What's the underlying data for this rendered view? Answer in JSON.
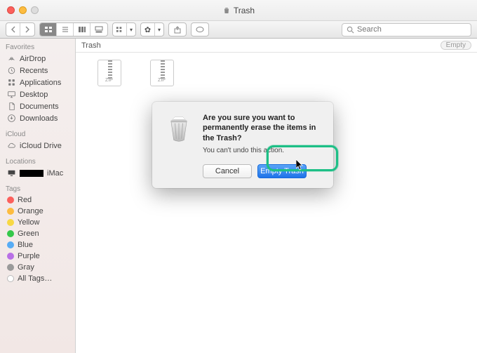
{
  "window": {
    "title": "Trash"
  },
  "toolbar": {
    "search_placeholder": "Search"
  },
  "pathbar": {
    "location": "Trash",
    "empty_label": "Empty"
  },
  "files": [
    {
      "type": "ZIP"
    },
    {
      "type": "ZIP"
    }
  ],
  "sidebar": {
    "sections": [
      {
        "heading": "Favorites",
        "items": [
          {
            "label": "AirDrop",
            "icon": "airdrop-icon"
          },
          {
            "label": "Recents",
            "icon": "recents-icon"
          },
          {
            "label": "Applications",
            "icon": "applications-icon"
          },
          {
            "label": "Desktop",
            "icon": "desktop-icon"
          },
          {
            "label": "Documents",
            "icon": "documents-icon"
          },
          {
            "label": "Downloads",
            "icon": "downloads-icon"
          }
        ]
      },
      {
        "heading": "iCloud",
        "items": [
          {
            "label": "iCloud Drive",
            "icon": "cloud-icon"
          }
        ]
      },
      {
        "heading": "Locations",
        "items": [
          {
            "label": "iMac",
            "icon": "display-icon",
            "redacted_prefix": true
          }
        ]
      },
      {
        "heading": "Tags",
        "items": [
          {
            "label": "Red",
            "dot": "#fc605c"
          },
          {
            "label": "Orange",
            "dot": "#fdbc40"
          },
          {
            "label": "Yellow",
            "dot": "#f8d843"
          },
          {
            "label": "Green",
            "dot": "#34c84a"
          },
          {
            "label": "Blue",
            "dot": "#57acf5"
          },
          {
            "label": "Purple",
            "dot": "#b970e6"
          },
          {
            "label": "Gray",
            "dot": "#9a9a9a"
          },
          {
            "label": "All Tags…",
            "dot": "#cfcfcf"
          }
        ]
      }
    ]
  },
  "dialog": {
    "title": "Are you sure you want to permanently erase the items in the Trash?",
    "message": "You can't undo this action.",
    "cancel_label": "Cancel",
    "confirm_label": "Empty Trash"
  }
}
